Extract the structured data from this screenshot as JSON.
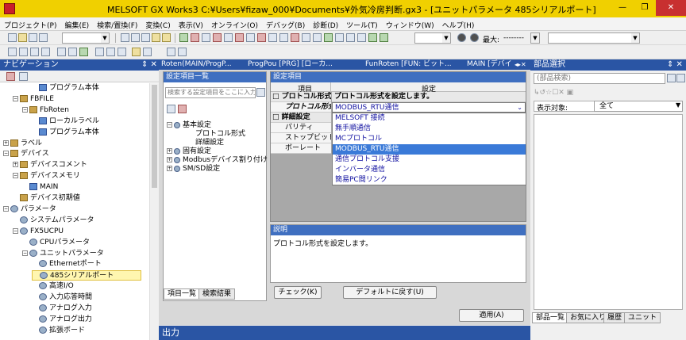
{
  "window": {
    "title": "MELSOFT GX Works3 C:¥Users¥fizaw_000¥Documents¥外気冷房判断.gx3 - [ユニットパラメータ 485シリアルポート]",
    "controls": [
      "—",
      "❐",
      "✕"
    ]
  },
  "menu": [
    "プロジェクト(P)",
    "編集(E)",
    "検索/置換(F)",
    "変換(C)",
    "表示(V)",
    "オンライン(O)",
    "デバッグ(B)",
    "診断(D)",
    "ツール(T)",
    "ウィンドウ(W)",
    "ヘルプ(H)"
  ],
  "toolbar": {
    "max_label": "最大:",
    "max_value": "--------"
  },
  "navigation": {
    "title": "ナビゲーション",
    "pin": "⇕ ✕",
    "items": [
      {
        "label": "プログラム本体",
        "indent": 3,
        "exp": "",
        "icon": "blue"
      },
      {
        "label": "FBFILE",
        "indent": 1,
        "exp": "−",
        "icon": "folder"
      },
      {
        "label": "FbRoten",
        "indent": 2,
        "exp": "−",
        "icon": "folder"
      },
      {
        "label": "ローカルラベル",
        "indent": 3,
        "exp": "",
        "icon": "blue"
      },
      {
        "label": "プログラム本体",
        "indent": 3,
        "exp": "",
        "icon": "blue"
      },
      {
        "label": "ラベル",
        "indent": 0,
        "exp": "+",
        "icon": "folder"
      },
      {
        "label": "デバイス",
        "indent": 0,
        "exp": "−",
        "icon": "folder"
      },
      {
        "label": "デバイスコメント",
        "indent": 1,
        "exp": "+",
        "icon": "folder"
      },
      {
        "label": "デバイスメモリ",
        "indent": 1,
        "exp": "−",
        "icon": "folder"
      },
      {
        "label": "MAIN",
        "indent": 2,
        "exp": "",
        "icon": "blue"
      },
      {
        "label": "デバイス初期値",
        "indent": 1,
        "exp": "",
        "icon": "folder"
      },
      {
        "label": "パラメータ",
        "indent": 0,
        "exp": "−",
        "icon": "gear"
      },
      {
        "label": "システムパラメータ",
        "indent": 1,
        "exp": "",
        "icon": "gear"
      },
      {
        "label": "FX5UCPU",
        "indent": 1,
        "exp": "−",
        "icon": "gear"
      },
      {
        "label": "CPUパラメータ",
        "indent": 2,
        "exp": "",
        "icon": "gear"
      },
      {
        "label": "ユニットパラメータ",
        "indent": 2,
        "exp": "−",
        "icon": "gear"
      },
      {
        "label": "Ethernetポート",
        "indent": 3,
        "exp": "",
        "icon": "gear"
      },
      {
        "label": "485シリアルポート",
        "indent": 3,
        "exp": "",
        "icon": "gear",
        "selected": true
      },
      {
        "label": "高速I/O",
        "indent": 3,
        "exp": "",
        "icon": "gear"
      },
      {
        "label": "入力応答時間",
        "indent": 3,
        "exp": "",
        "icon": "gear"
      },
      {
        "label": "アナログ入力",
        "indent": 3,
        "exp": "",
        "icon": "gear"
      },
      {
        "label": "アナログ出力",
        "indent": 3,
        "exp": "",
        "icon": "gear"
      },
      {
        "label": "拡張ボード",
        "indent": 3,
        "exp": "",
        "icon": "gear"
      }
    ]
  },
  "doc_tabs": [
    "Roten(MAIN/ProgP...",
    "ProgPou [PRG] [ローカ...",
    "FunRoten [FUN: ビット...",
    "MAIN [デバイ"
  ],
  "settings_list": {
    "title": "設定項目一覧",
    "search_placeholder": "検索する設定項目をここに入力",
    "tree": [
      {
        "label": "基本設定",
        "level": 0,
        "exp": "−"
      },
      {
        "label": "プロトコル形式",
        "level": 1,
        "exp": ""
      },
      {
        "label": "詳細設定",
        "level": 1,
        "exp": ""
      },
      {
        "label": "固有設定",
        "level": 0,
        "exp": "+"
      },
      {
        "label": "Modbusデバイス割り付け",
        "level": 0,
        "exp": "+"
      },
      {
        "label": "SM/SD設定",
        "level": 0,
        "exp": "+"
      }
    ],
    "tabs": [
      "項目一覧",
      "検索結果"
    ]
  },
  "settings_grid": {
    "title": "設定項目",
    "col_item": "項目",
    "col_setting": "設定",
    "rows": [
      {
        "label": "プロトコル形式",
        "value": "プロトコル形式を設定します。",
        "group": true
      },
      {
        "label": "プロトコル形式",
        "value": "MODBUS_RTU通信",
        "group": false,
        "combo": true
      },
      {
        "label": "詳細設定",
        "value": "",
        "group": true
      },
      {
        "label": "パリティ",
        "value": "",
        "group": false
      },
      {
        "label": "ストップビット",
        "value": "",
        "group": false
      },
      {
        "label": "ボーレート",
        "value": "",
        "group": false
      }
    ],
    "dropdown": [
      "MELSOFT 接続",
      "無手順通信",
      "MCプロトコル",
      "MODBUS_RTU通信",
      "通信プロトコル支援",
      "インバータ通信",
      "簡易PC間リンク"
    ],
    "dropdown_selected": 3
  },
  "description": {
    "title": "説明",
    "text": "プロトコル形式を設定します。"
  },
  "buttons": {
    "check": "チェック(K)",
    "default": "デフォルトに戻す(U)",
    "apply": "適用(A)"
  },
  "parts": {
    "title": "部品選択",
    "search_placeholder": "(部品検索)",
    "display_label": "表示対象:",
    "display_value": "全て",
    "tabs": [
      "部品一覧",
      "お気に入り",
      "履歴",
      "ユニット"
    ]
  },
  "output": {
    "title": "出力"
  }
}
